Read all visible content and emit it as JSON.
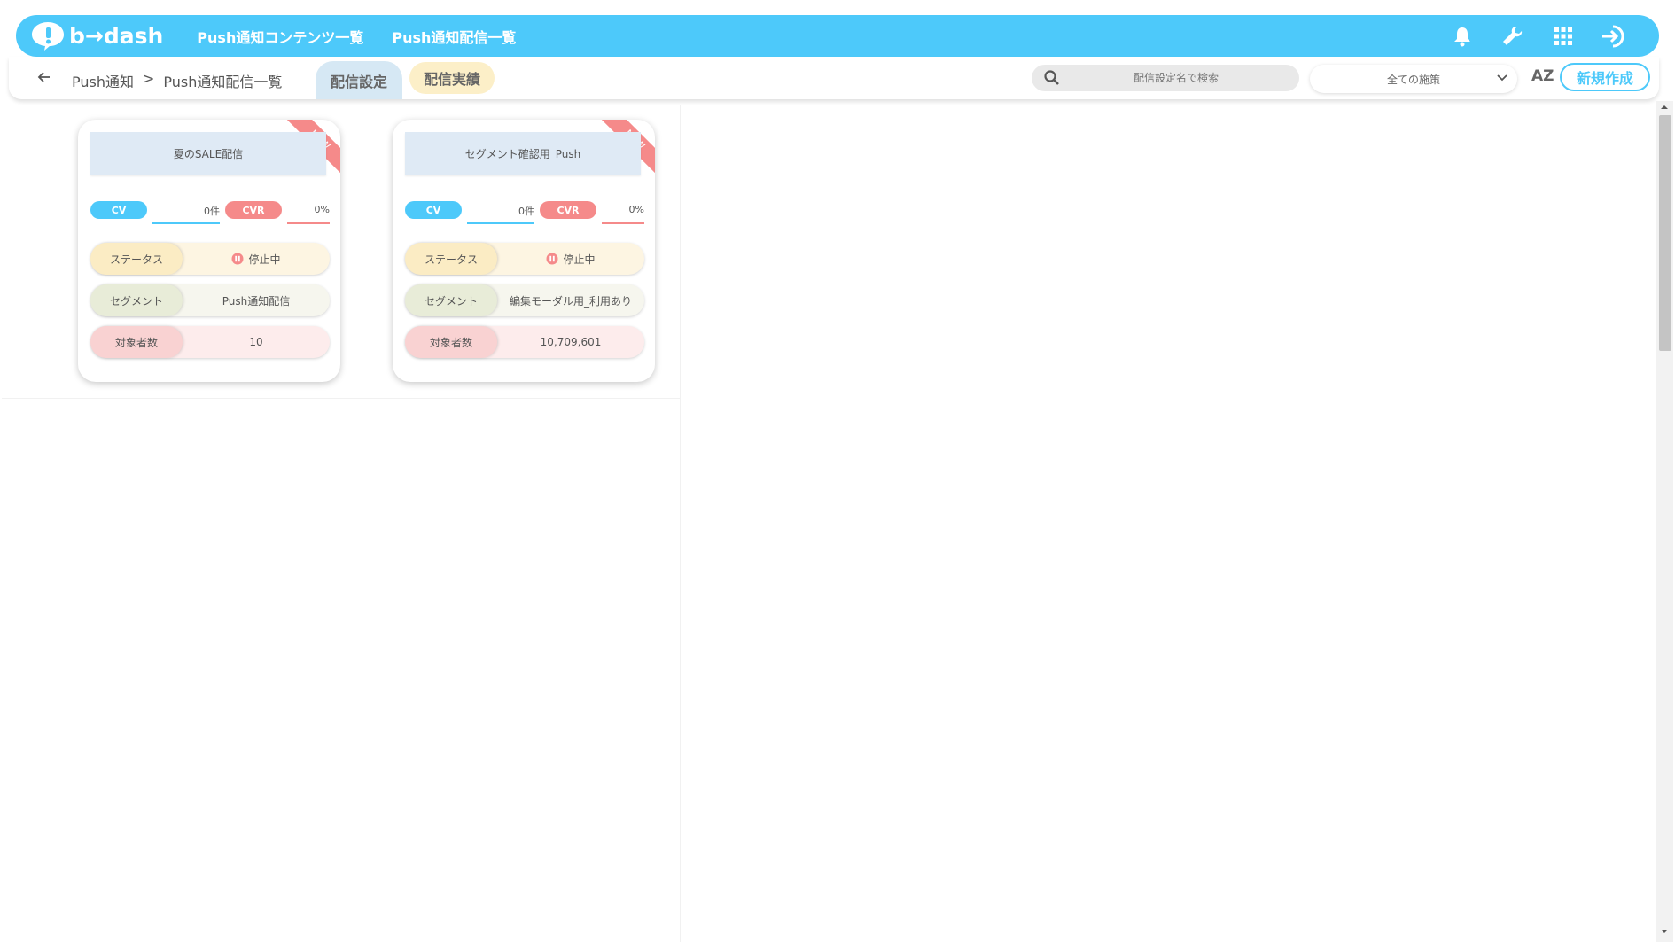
{
  "header": {
    "logo_text": "b→dash",
    "nav": [
      "Push通知コンテンツ一覧",
      "Push通知配信一覧"
    ],
    "icons": [
      "bell-icon",
      "wrench-icon",
      "grid-icon",
      "logout-icon"
    ],
    "accent_color": "#4dc9fa"
  },
  "subbar": {
    "breadcrumb": {
      "parent": "Push通知",
      "separator": ">",
      "current": "Push通知配信一覧"
    },
    "tabs": [
      "配信設定",
      "配信実績"
    ],
    "search_placeholder": "配信設定名で検索",
    "filter_selected": "全ての施策",
    "sort_label": "AZ",
    "new_button": "新規作成"
  },
  "cards": [
    {
      "title": "夏のSALE配信",
      "badge": "NEW",
      "cv_label": "CV",
      "cv_value": "0件",
      "cvr_label": "CVR",
      "cvr_value": "0%",
      "status_label": "ステータス",
      "status_value": "停止中",
      "segment_label": "セグメント",
      "segment_value": "Push通知配信",
      "target_label": "対象者数",
      "target_value": "10"
    },
    {
      "title": "セグメント確認用_Push",
      "badge": "NEW",
      "cv_label": "CV",
      "cv_value": "0件",
      "cvr_label": "CVR",
      "cvr_value": "0%",
      "status_label": "ステータス",
      "status_value": "停止中",
      "segment_label": "セグメント",
      "segment_value": "編集モーダル用_利用あり",
      "target_label": "対象者数",
      "target_value": "10,709,601"
    }
  ]
}
